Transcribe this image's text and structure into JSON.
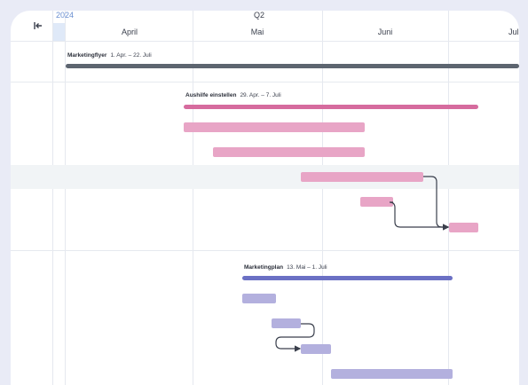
{
  "header": {
    "year": "2024",
    "quarter": "Q2",
    "months": [
      "April",
      "Mai",
      "Juni",
      "Juli"
    ]
  },
  "projects": [
    {
      "name": "Marketingflyer",
      "dates": "1. Apr. – 22. Juli",
      "color": "#5d6570"
    },
    {
      "name": "Aushilfe einstellen",
      "dates": "29. Apr. – 7. Juli",
      "color": "#d66b9e"
    },
    {
      "name": "Marketingplan",
      "dates": "13. Mai – 1. Juli",
      "color": "#6b70c4"
    }
  ],
  "colors": {
    "task_pink": "#e8a5c6",
    "task_purple": "#b3b0de",
    "arrow": "#3a3f4c",
    "background": "#e9ebf6"
  },
  "icons": {
    "collapse": "collapse-left-icon"
  }
}
